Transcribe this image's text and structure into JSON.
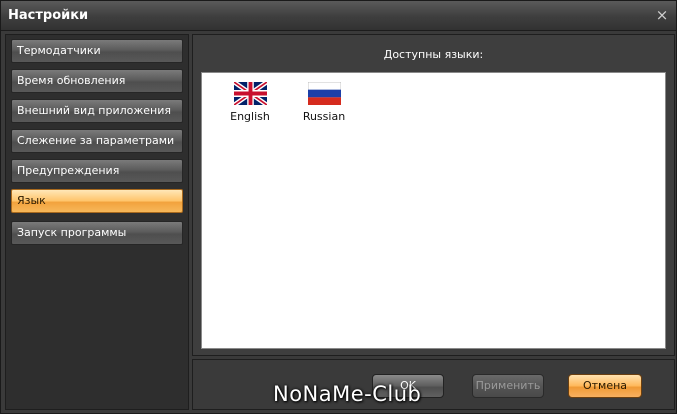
{
  "window": {
    "title": "Настройки",
    "close_glyph": "×"
  },
  "sidebar": {
    "items": [
      {
        "label": "Термодатчики",
        "active": false
      },
      {
        "label": "Время обновления",
        "active": false
      },
      {
        "label": "Внешний вид приложения",
        "active": false
      },
      {
        "label": "Слежение за параметрами",
        "active": false
      },
      {
        "label": "Предупреждения",
        "active": false
      },
      {
        "label": "Язык",
        "active": true
      },
      {
        "label": "Запуск программы",
        "active": false
      }
    ]
  },
  "content": {
    "header": "Доступны языки:",
    "languages": [
      {
        "name": "English",
        "flag": "uk-flag-icon"
      },
      {
        "name": "Russian",
        "flag": "russia-flag-icon"
      }
    ]
  },
  "buttons": {
    "ok": "OK",
    "apply": "Применить",
    "cancel": "Отмена"
  },
  "watermark": "NoNaMe-Club",
  "colors": {
    "accent": "#f7b85a",
    "panel": "#3a3a3a"
  }
}
